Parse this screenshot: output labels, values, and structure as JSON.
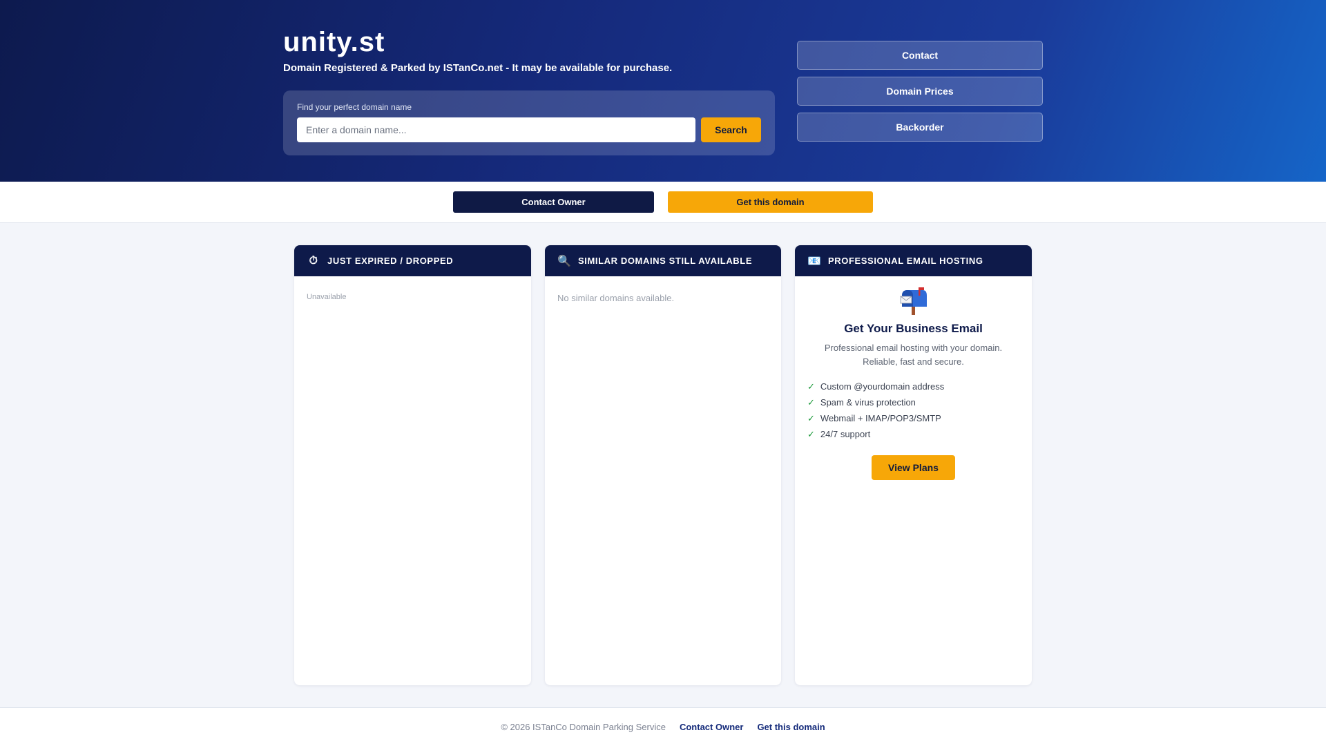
{
  "hero": {
    "domain": "unity.st",
    "subtitle": "Domain Registered & Parked by ISTanCo.net - It may be available for purchase.",
    "search": {
      "label": "Find your perfect domain name",
      "placeholder": "Enter a domain name...",
      "value": "",
      "button": "Search"
    },
    "buttons": [
      "Contact",
      "Domain Prices",
      "Backorder"
    ]
  },
  "cta": {
    "contact_owner": "Contact Owner",
    "get_domain": "Get this domain"
  },
  "cards": {
    "expired": {
      "icon": "stopwatch-icon",
      "glyph": "⏱",
      "title": "JUST EXPIRED / DROPPED",
      "status": "Unavailable"
    },
    "similar": {
      "icon": "magnifier-icon",
      "glyph": "🔍",
      "title": "SIMILAR DOMAINS STILL AVAILABLE",
      "status": "No similar domains available."
    },
    "email": {
      "icon": "email-icon",
      "glyph": "📧",
      "illustration": "mailbox-icon",
      "title": "PROFESSIONAL EMAIL HOSTING",
      "heading": "Get Your Business Email",
      "description": "Professional email hosting with your domain. Reliable, fast and secure.",
      "features": [
        "Custom @yourdomain address",
        "Spam & virus protection",
        "Webmail + IMAP/POP3/SMTP",
        "24/7 support"
      ],
      "check_glyph": "✓",
      "button": "View Plans"
    }
  },
  "footer": {
    "copyright": "© 2026 ISTanCo Domain Parking Service",
    "links": [
      "Contact Owner",
      "Get this domain"
    ]
  },
  "colors": {
    "navy": "#0e1a4a",
    "accent": "#f7a708",
    "check": "#1e9b3c",
    "hero_gradient_end": "#1565c8"
  }
}
